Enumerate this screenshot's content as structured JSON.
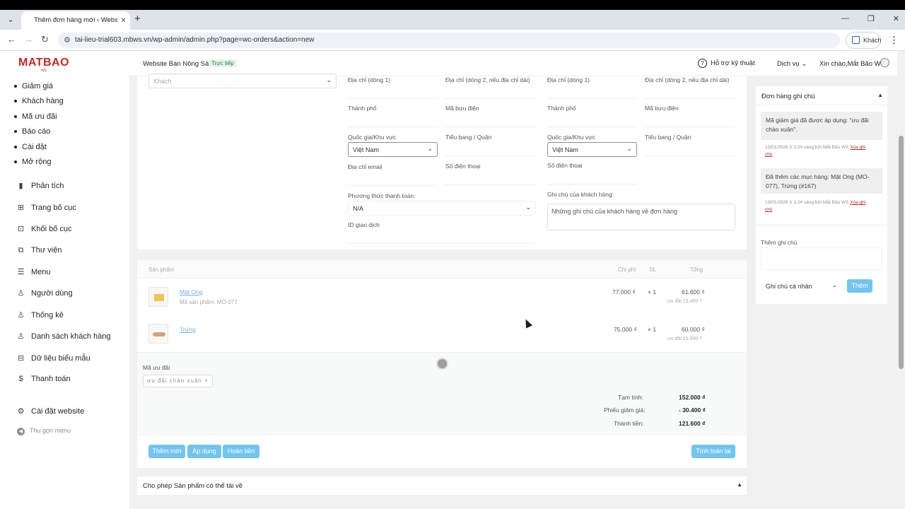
{
  "browser": {
    "tab_title": "Thêm đơn hàng mới ‹ Website",
    "url": "tai-lieu-trial603.mbws.vn/wp-admin/admin.php?page=wc-orders&action=new",
    "guest_label": "Khách"
  },
  "logo": {
    "text": "MATBAO",
    "sub": "WS"
  },
  "sidebar": {
    "sub_items": [
      "Giảm giá",
      "Khách hàng",
      "Mã ưu đãi",
      "Báo cáo",
      "Cài đặt",
      "Mở rộng"
    ],
    "items": [
      {
        "label": "Phân tích",
        "icon": "bar-chart-icon"
      },
      {
        "label": "Trang bố cục",
        "icon": "layout-icon"
      },
      {
        "label": "Khối bố cục",
        "icon": "blocks-icon"
      },
      {
        "label": "Thư viện",
        "icon": "media-icon"
      },
      {
        "label": "Menu",
        "icon": "menu-icon"
      },
      {
        "label": "Người dùng",
        "icon": "user-icon"
      },
      {
        "label": "Thống kê",
        "icon": "stats-icon"
      },
      {
        "label": "Danh sách khách hàng",
        "icon": "customer-list-icon"
      },
      {
        "label": "Dữ liệu biểu mẫu",
        "icon": "form-data-icon"
      },
      {
        "label": "Thanh toán",
        "icon": "payment-icon"
      },
      {
        "label": "Cài đặt website",
        "icon": "settings-icon"
      }
    ],
    "collapse_label": "Thu gọn menu"
  },
  "adminbar": {
    "site_name": "Website Bán Nông Sản",
    "live_badge": "Trực tiếp",
    "help": "Hỗ trợ kỹ thuật",
    "services": "Dịch vụ",
    "greeting": "Xin chào,Mắt Bão WS"
  },
  "customer": {
    "placeholder": "Khách"
  },
  "billing": {
    "address1": "Địa chỉ (dòng 1)",
    "address2": "Địa chỉ (dòng 2, nếu địa chỉ dài)",
    "city": "Thành phố",
    "postcode": "Mã bưu điện",
    "country": "Quốc gia/Khu vực",
    "country_value": "Việt Nam",
    "state": "Tiểu bang / Quận",
    "email": "Địa chỉ email",
    "phone": "Số điện thoại",
    "payment_method": "Phương thức thanh toán:",
    "payment_value": "N/A",
    "transaction_id": "ID giao dịch"
  },
  "shipping": {
    "address1": "Địa chỉ (dòng 1)",
    "address2": "Địa chỉ (dòng 2, nếu địa chỉ dài)",
    "city": "Thành phố",
    "postcode": "Mã bưu điện",
    "country": "Quốc gia/Khu vực",
    "country_value": "Việt Nam",
    "state": "Tiểu bang / Quận",
    "phone": "Số điện thoại",
    "customer_note_label": "Ghi chú của khách hàng:",
    "customer_note_placeholder": "Những ghi chú của khách hàng về đơn hàng"
  },
  "items_table": {
    "headers": {
      "product": "Sản phẩm",
      "cost": "Chi phí",
      "qty": "SL",
      "total": "Tổng"
    },
    "rows": [
      {
        "name": "Mật Ong",
        "sku": "Mã sản phẩm: MO-077",
        "cost": "77.000 ₫",
        "qty": "× 1",
        "total": "61.600 ₫",
        "discount": "ưu đãi 15.400 ₫"
      },
      {
        "name": "Trứng",
        "sku": "",
        "cost": "75.000 ₫",
        "qty": "× 1",
        "total": "60.000 ₫",
        "discount": "ưu đãi 15.000 ₫"
      }
    ]
  },
  "coupon": {
    "label": "Mã ưu đãi",
    "code": "ưu đãi chào xuân",
    "remove": "×"
  },
  "totals": {
    "subtotal_label": "Tạm tính:",
    "subtotal": "152.000 ₫",
    "discount_label": "Phiếu giảm giá:",
    "discount": "- 30.400 ₫",
    "total_label": "Thành tiền:",
    "total": "121.600 ₫"
  },
  "actions": {
    "add": "Thêm mới",
    "apply": "Áp dụng",
    "refund": "Hoàn tiền",
    "recalc": "Tính toán lại"
  },
  "downloads": {
    "title": "Cho phép Sản phẩm có thể tải về"
  },
  "notes": {
    "title": "Đơn hàng ghi chú",
    "list": [
      {
        "text": "Mã giảm giá đã được áp dụng: \"ưu đãi chào xuân\".",
        "meta": "13/01/2026 ở 3:24 sáng bởi Mắt Bão WS",
        "delete": "Xóa ghi chú"
      },
      {
        "text": "Đã thêm các mục hàng: Mật Ong (MO-077), Trứng (#167)",
        "meta": "13/01/2026 ở 3:24 sáng bởi Mắt Bão WS",
        "delete": "Xóa ghi chú"
      }
    ],
    "add_label": "Thêm ghi chú",
    "type_value": "Ghi chú cá nhân",
    "add_button": "Thêm"
  }
}
